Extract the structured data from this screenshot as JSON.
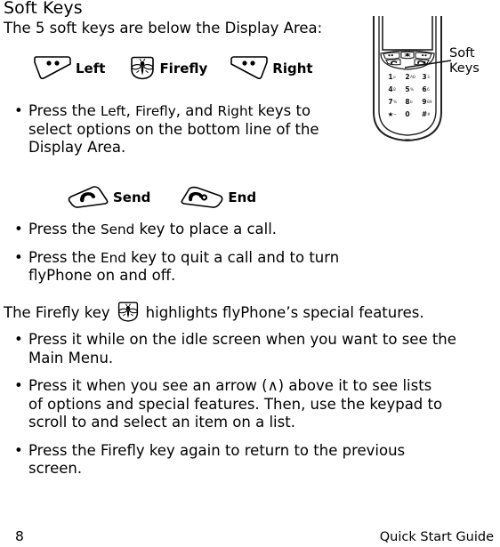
{
  "document": {
    "title": "Soft Keys",
    "intro": "The 5 soft keys are below the Display Area:"
  },
  "softkey_legend": {
    "left_label": "Left",
    "firefly_label": "Firefly",
    "right_label": "Right",
    "left_icon": "left-softkey-icon",
    "firefly_icon": "firefly-key-icon",
    "right_icon": "right-softkey-icon"
  },
  "callkey_legend": {
    "send_label": "Send",
    "end_label": "End",
    "send_icon": "send-key-icon",
    "end_icon": "end-key-icon"
  },
  "bullets_softkeys": [
    {
      "line1_pre": "Press the ",
      "line1_k1": "Left",
      "line1_mid1": ", ",
      "line1_k2": "Firefly",
      "line1_mid2": ", and ",
      "line1_k3": "Right",
      "line1_post": " keys to",
      "line2": "select options on the bottom line of the",
      "line3": "Display Area."
    }
  ],
  "bullets_callkeys": [
    {
      "pre": "Press the ",
      "key": "Send",
      "post": " key to place a call."
    },
    {
      "pre": "Press the ",
      "key": "End",
      "post": " key to quit a call and to turn",
      "line2": "flyPhone on and off."
    }
  ],
  "firefly_intro": {
    "pre": "The Firefly key",
    "post": "highlights flyPhone’s special features."
  },
  "bullets_firefly": [
    {
      "line1": "Press it while on the idle screen when you want to see the",
      "line2": "Main Menu."
    },
    {
      "line1": "Press it when you see an arrow (∧) above it to see lists",
      "line2": "of options and special features. Then, use the keypad to",
      "line3": "scroll to and select an item on a list."
    },
    {
      "line1": "Press the Firefly key again to return to the previous",
      "line2": "screen."
    }
  ],
  "bullet_marker": "•",
  "phone_figure": {
    "callout_line1": "Soft",
    "callout_line2": "Keys",
    "keypad": [
      [
        "1",
        "2",
        "3"
      ],
      [
        "4",
        "5",
        "6"
      ],
      [
        "7",
        "8",
        "9"
      ],
      [
        "★",
        "0",
        "#"
      ]
    ],
    "display_area_label": "display-screen"
  },
  "footer": {
    "page_number": "8",
    "guide_label": "Quick Start Guide"
  },
  "colors": {
    "ink": "#000000",
    "paper": "#ffffff",
    "figure_line": "#1a1a1a"
  }
}
